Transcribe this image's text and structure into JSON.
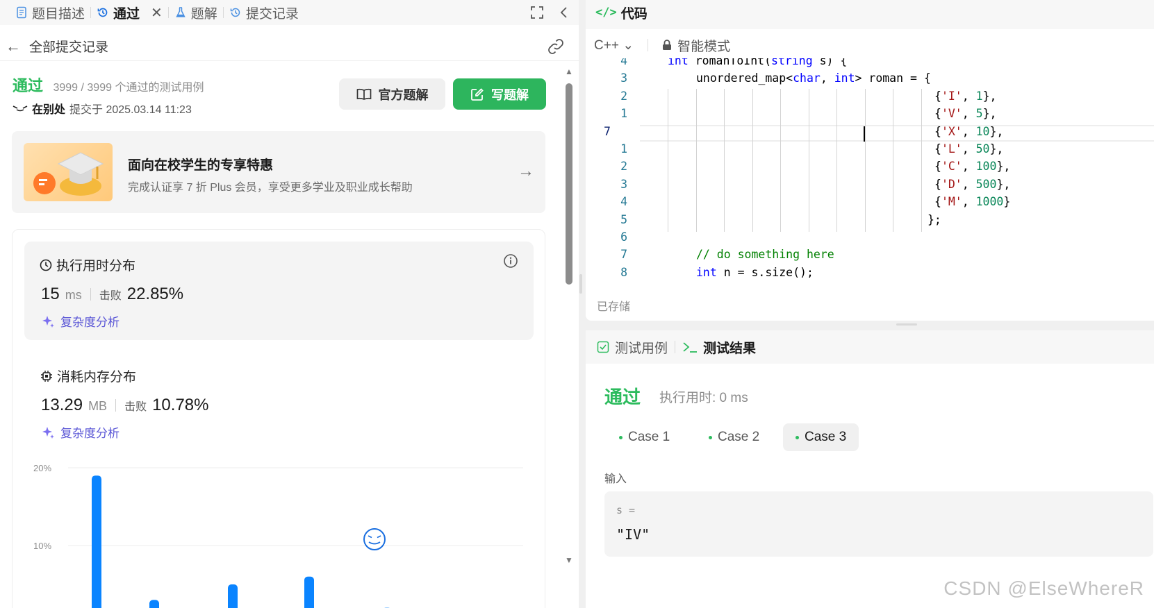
{
  "left_tabs": [
    {
      "label": "题目描述",
      "icon": "document-icon"
    },
    {
      "label": "通过",
      "icon": "history-icon",
      "active": true,
      "closable": true
    },
    {
      "label": "题解",
      "icon": "flask-icon"
    },
    {
      "label": "提交记录",
      "icon": "history-icon"
    }
  ],
  "header": {
    "back_label": "全部提交记录"
  },
  "result": {
    "status": "通过",
    "cases_text": "3999 / 3999 个通过的测试用例",
    "user": "在别处",
    "submitted_text": "提交于 2025.03.14 11:23"
  },
  "buttons": {
    "official": "官方题解",
    "write": "写题解"
  },
  "promo": {
    "title": "面向在校学生的专享特惠",
    "subtitle": "完成认证享 7 折 Plus 会员，享受更多学业及职业成长帮助"
  },
  "runtime": {
    "title": "执行用时分布",
    "value": "15",
    "unit": "ms",
    "beat_label": "击败",
    "beat_pct": "22.85%",
    "analysis": "复杂度分析"
  },
  "memory": {
    "title": "消耗内存分布",
    "value": "13.29",
    "unit": "MB",
    "beat_label": "击败",
    "beat_pct": "10.78%",
    "analysis": "复杂度分析"
  },
  "chart_data": {
    "type": "bar",
    "y_ticks": [
      "20%",
      "10%"
    ],
    "ylim": [
      0,
      20
    ],
    "values": [
      19,
      3,
      5,
      6,
      2
    ]
  },
  "code": {
    "title": "代码",
    "language": "C++",
    "mode": "智能模式",
    "saved": "已存储",
    "lines": [
      {
        "n": "4",
        "text": "int romanToInt(string s) {"
      },
      {
        "n": "3",
        "text": "unordered_map<char, int> roman = {"
      },
      {
        "n": "2",
        "text": "{'I', 1},"
      },
      {
        "n": "1",
        "text": "{'V', 5},"
      },
      {
        "n": "7",
        "text": "{'X', 10},"
      },
      {
        "n": "1",
        "text": "{'L', 50},"
      },
      {
        "n": "2",
        "text": "{'C', 100},"
      },
      {
        "n": "3",
        "text": "{'D', 500},"
      },
      {
        "n": "4",
        "text": "{'M', 1000}"
      },
      {
        "n": "5",
        "text": "};"
      },
      {
        "n": "6",
        "text": ""
      },
      {
        "n": "7",
        "text": "// do something here"
      },
      {
        "n": "8",
        "text": "int n = s.size();"
      }
    ]
  },
  "test": {
    "tab_cases": "测试用例",
    "tab_result": "测试结果",
    "status": "通过",
    "time_text": "执行用时: 0 ms",
    "cases": [
      "Case 1",
      "Case 2",
      "Case 3"
    ],
    "active_case": 2,
    "input_label": "输入",
    "var_label": "s =",
    "var_value": "\"IV\""
  },
  "watermark": "CSDN @ElseWhereR",
  "colors": {
    "accent_green": "#2cbb5d",
    "button_green": "#2db55d",
    "bar_blue": "#0a84ff",
    "analysis_purple": "#5b57d6"
  }
}
